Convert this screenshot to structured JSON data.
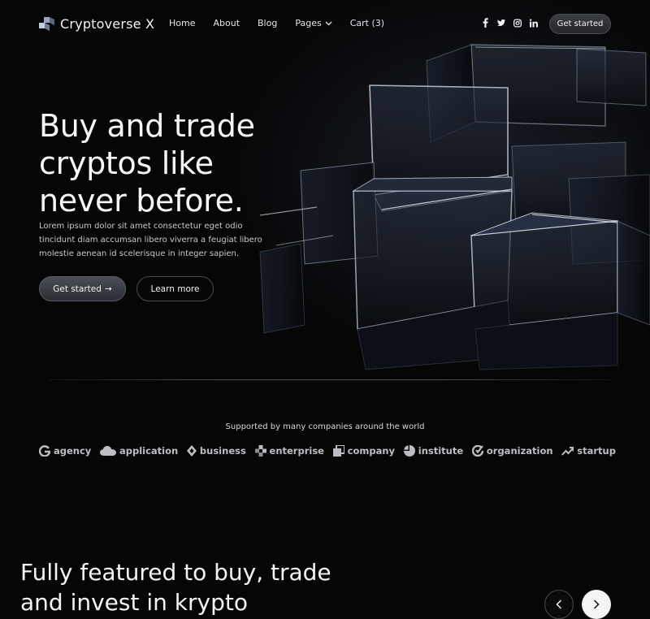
{
  "nav": {
    "brand": "Cryptoverse X",
    "menu": [
      {
        "label": "Home"
      },
      {
        "label": "About"
      },
      {
        "label": "Blog"
      },
      {
        "label": "Pages"
      },
      {
        "label": "Cart (3)"
      }
    ],
    "social": [
      "facebook-icon",
      "twitter-icon",
      "instagram-icon",
      "linkedin-icon"
    ],
    "cta": "Get started"
  },
  "hero": {
    "title": "Buy and trade cryptos like never before.",
    "description": "Lorem ipsum dolor sit amet consectetur eget odio tincidunt diam accumsan libero viverra a feugiat libero molestie aenean id scelerisque in integer sapien.",
    "primary_button": "Get started",
    "primary_arrow": "→",
    "secondary_button": "Learn more"
  },
  "partners": {
    "heading": "Supported by many companies around the world",
    "brands": [
      "agency",
      "application",
      "business",
      "enterprise",
      "company",
      "institute",
      "organization",
      "startup"
    ]
  },
  "features": {
    "title": "Fully featured to buy,  trade and invest in krypto"
  },
  "carousel": {
    "prev_icon": "chevron-left-icon",
    "next_icon": "chevron-right-icon"
  },
  "colors": {
    "background": "#060607",
    "text": "#f4f4f6",
    "muted": "#bdbdc3",
    "button": "#3b3d44",
    "next_button": "#f5f5f7"
  }
}
